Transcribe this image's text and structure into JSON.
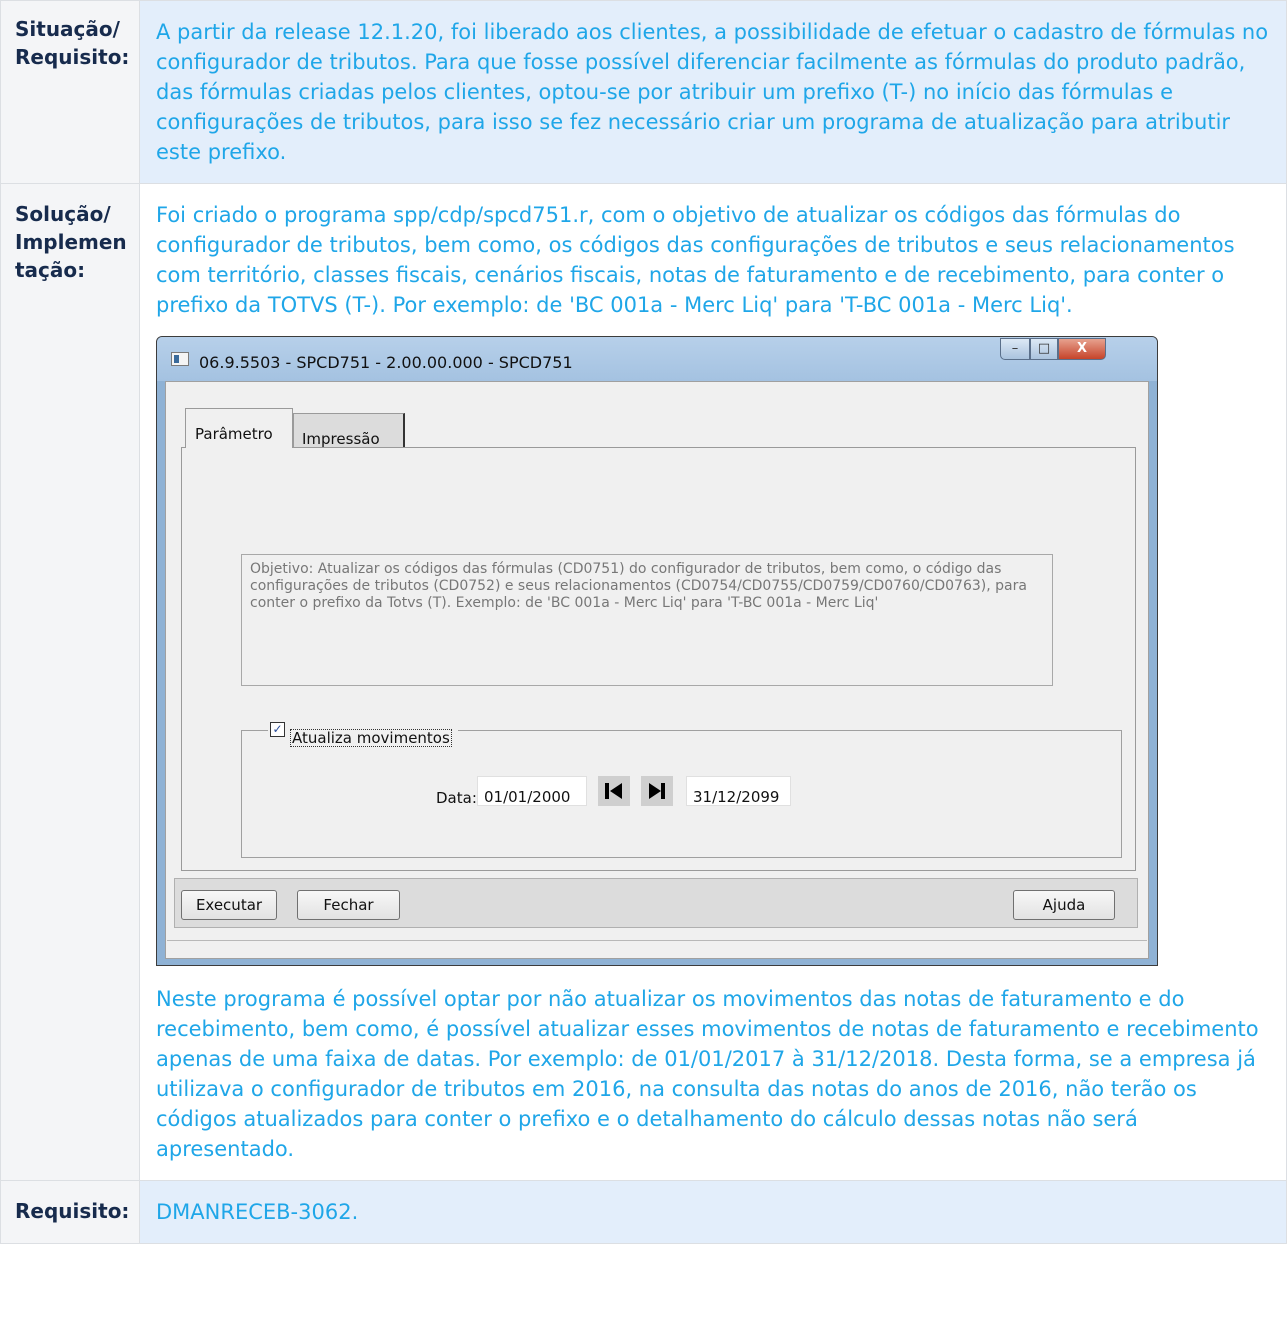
{
  "rows": [
    {
      "label_lines": [
        "Situação/",
        "Requisito:"
      ],
      "text": "A partir da release 12.1.20, foi liberado aos clientes, a possibilidade de efetuar o cadastro de fórmulas no configurador de tributos. Para que fosse possível diferenciar facilmente as fórmulas do produto padrão, das fórmulas criadas pelos clientes, optou-se por atribuir um prefixo (T-) no início das fórmulas e configurações de tributos, para isso se fez necessário criar um programa de atualização para atributir este prefixo."
    },
    {
      "label_lines": [
        "Solução/",
        "Implemen",
        "tação:"
      ],
      "text_before": "Foi criado o programa spp/cdp/spcd751.r, com o objetivo de atualizar os códigos das fórmulas do configurador de tributos, bem como, os códigos das configurações de tributos e seus relacionamentos com território, classes fiscais, cenários fiscais, notas de faturamento e de recebimento, para conter o prefixo da TOTVS (T-). Por exemplo: de 'BC 001a - Merc Liq' para 'T-BC 001a - Merc Liq'.",
      "text_after": "Neste programa é possível optar por não atualizar os movimentos das notas de faturamento e do recebimento, bem como, é possível atualizar esses movimentos de notas de faturamento e recebimento apenas de uma faixa de datas. Por exemplo: de 01/01/2017 à 31/12/2018. Desta forma, se a empresa já utilizava o configurador de tributos em 2016, na consulta das notas do anos de 2016, não terão os códigos atualizados para conter o prefixo e o detalhamento do cálculo dessas notas não será apresentado."
    },
    {
      "label": "Requisito:",
      "text": "DMANRECEB-3062."
    }
  ],
  "dialog": {
    "title": "06.9.5503 - SPCD751 - 2.00.00.000 - SPCD751",
    "window_buttons": {
      "minimize": "–",
      "maximize": "□",
      "close": "X"
    },
    "tabs": [
      "Parâmetro",
      "Impressão"
    ],
    "objective": "Objetivo: Atualizar os códigos das fórmulas (CD0751) do configurador de tributos, bem como, o código das configurações de tributos (CD0752) e seus relacionamentos (CD0754/CD0755/CD0759/CD0760/CD0763), para conter o prefixo da Totvs (T). Exemplo: de 'BC 001a - Merc Liq' para 'T-BC 001a - Merc Liq'",
    "checkbox_label": "Atualiza movimentos",
    "checkbox_checked": true,
    "checkmark": "✓",
    "date_label": "Data:",
    "date_start": "01/01/2000",
    "date_end": "31/12/2099",
    "buttons": {
      "execute": "Executar",
      "close": "Fechar",
      "help": "Ajuda"
    }
  },
  "colors": {
    "body_text": "#1fa6e8",
    "label_text": "#172b4d",
    "row_bg": "#e3eefb"
  }
}
